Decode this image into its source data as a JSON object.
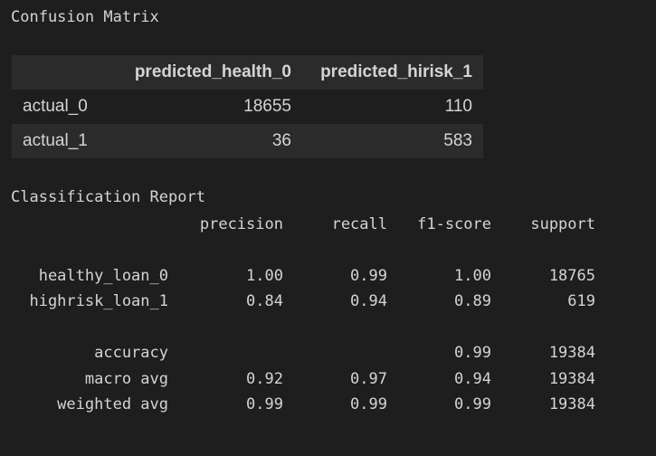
{
  "confusion_matrix": {
    "title": "Confusion Matrix",
    "columns": [
      "",
      "predicted_health_0",
      "predicted_hirisk_1"
    ],
    "rows": [
      {
        "label": "actual_0",
        "values": [
          "18655",
          "110"
        ]
      },
      {
        "label": "actual_1",
        "values": [
          "36",
          "583"
        ]
      }
    ]
  },
  "classification_report": {
    "title": "Classification Report",
    "header": [
      "precision",
      "recall",
      "f1-score",
      "support"
    ],
    "rows": [
      {
        "label": "healthy_loan_0",
        "precision": "1.00",
        "recall": "0.99",
        "f1": "1.00",
        "support": "18765"
      },
      {
        "label": "highrisk_loan_1",
        "precision": "0.84",
        "recall": "0.94",
        "f1": "0.89",
        "support": "619"
      },
      {
        "label": "accuracy",
        "precision": "",
        "recall": "",
        "f1": "0.99",
        "support": "19384"
      },
      {
        "label": "macro avg",
        "precision": "0.92",
        "recall": "0.97",
        "f1": "0.94",
        "support": "19384"
      },
      {
        "label": "weighted avg",
        "precision": "0.99",
        "recall": "0.99",
        "f1": "0.99",
        "support": "19384"
      }
    ]
  },
  "colors": {
    "background": "#1e1e1e",
    "text": "#d4d4d4",
    "row_stripe": "#2b2b2b"
  }
}
